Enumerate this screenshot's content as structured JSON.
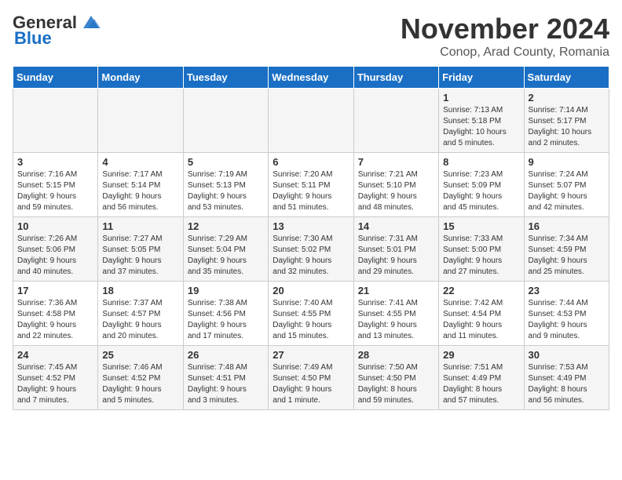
{
  "header": {
    "logo_line1": "General",
    "logo_line2": "Blue",
    "month": "November 2024",
    "location": "Conop, Arad County, Romania"
  },
  "weekdays": [
    "Sunday",
    "Monday",
    "Tuesday",
    "Wednesday",
    "Thursday",
    "Friday",
    "Saturday"
  ],
  "weeks": [
    [
      {
        "day": "",
        "info": ""
      },
      {
        "day": "",
        "info": ""
      },
      {
        "day": "",
        "info": ""
      },
      {
        "day": "",
        "info": ""
      },
      {
        "day": "",
        "info": ""
      },
      {
        "day": "1",
        "info": "Sunrise: 7:13 AM\nSunset: 5:18 PM\nDaylight: 10 hours\nand 5 minutes."
      },
      {
        "day": "2",
        "info": "Sunrise: 7:14 AM\nSunset: 5:17 PM\nDaylight: 10 hours\nand 2 minutes."
      }
    ],
    [
      {
        "day": "3",
        "info": "Sunrise: 7:16 AM\nSunset: 5:15 PM\nDaylight: 9 hours\nand 59 minutes."
      },
      {
        "day": "4",
        "info": "Sunrise: 7:17 AM\nSunset: 5:14 PM\nDaylight: 9 hours\nand 56 minutes."
      },
      {
        "day": "5",
        "info": "Sunrise: 7:19 AM\nSunset: 5:13 PM\nDaylight: 9 hours\nand 53 minutes."
      },
      {
        "day": "6",
        "info": "Sunrise: 7:20 AM\nSunset: 5:11 PM\nDaylight: 9 hours\nand 51 minutes."
      },
      {
        "day": "7",
        "info": "Sunrise: 7:21 AM\nSunset: 5:10 PM\nDaylight: 9 hours\nand 48 minutes."
      },
      {
        "day": "8",
        "info": "Sunrise: 7:23 AM\nSunset: 5:09 PM\nDaylight: 9 hours\nand 45 minutes."
      },
      {
        "day": "9",
        "info": "Sunrise: 7:24 AM\nSunset: 5:07 PM\nDaylight: 9 hours\nand 42 minutes."
      }
    ],
    [
      {
        "day": "10",
        "info": "Sunrise: 7:26 AM\nSunset: 5:06 PM\nDaylight: 9 hours\nand 40 minutes."
      },
      {
        "day": "11",
        "info": "Sunrise: 7:27 AM\nSunset: 5:05 PM\nDaylight: 9 hours\nand 37 minutes."
      },
      {
        "day": "12",
        "info": "Sunrise: 7:29 AM\nSunset: 5:04 PM\nDaylight: 9 hours\nand 35 minutes."
      },
      {
        "day": "13",
        "info": "Sunrise: 7:30 AM\nSunset: 5:02 PM\nDaylight: 9 hours\nand 32 minutes."
      },
      {
        "day": "14",
        "info": "Sunrise: 7:31 AM\nSunset: 5:01 PM\nDaylight: 9 hours\nand 29 minutes."
      },
      {
        "day": "15",
        "info": "Sunrise: 7:33 AM\nSunset: 5:00 PM\nDaylight: 9 hours\nand 27 minutes."
      },
      {
        "day": "16",
        "info": "Sunrise: 7:34 AM\nSunset: 4:59 PM\nDaylight: 9 hours\nand 25 minutes."
      }
    ],
    [
      {
        "day": "17",
        "info": "Sunrise: 7:36 AM\nSunset: 4:58 PM\nDaylight: 9 hours\nand 22 minutes."
      },
      {
        "day": "18",
        "info": "Sunrise: 7:37 AM\nSunset: 4:57 PM\nDaylight: 9 hours\nand 20 minutes."
      },
      {
        "day": "19",
        "info": "Sunrise: 7:38 AM\nSunset: 4:56 PM\nDaylight: 9 hours\nand 17 minutes."
      },
      {
        "day": "20",
        "info": "Sunrise: 7:40 AM\nSunset: 4:55 PM\nDaylight: 9 hours\nand 15 minutes."
      },
      {
        "day": "21",
        "info": "Sunrise: 7:41 AM\nSunset: 4:55 PM\nDaylight: 9 hours\nand 13 minutes."
      },
      {
        "day": "22",
        "info": "Sunrise: 7:42 AM\nSunset: 4:54 PM\nDaylight: 9 hours\nand 11 minutes."
      },
      {
        "day": "23",
        "info": "Sunrise: 7:44 AM\nSunset: 4:53 PM\nDaylight: 9 hours\nand 9 minutes."
      }
    ],
    [
      {
        "day": "24",
        "info": "Sunrise: 7:45 AM\nSunset: 4:52 PM\nDaylight: 9 hours\nand 7 minutes."
      },
      {
        "day": "25",
        "info": "Sunrise: 7:46 AM\nSunset: 4:52 PM\nDaylight: 9 hours\nand 5 minutes."
      },
      {
        "day": "26",
        "info": "Sunrise: 7:48 AM\nSunset: 4:51 PM\nDaylight: 9 hours\nand 3 minutes."
      },
      {
        "day": "27",
        "info": "Sunrise: 7:49 AM\nSunset: 4:50 PM\nDaylight: 9 hours\nand 1 minute."
      },
      {
        "day": "28",
        "info": "Sunrise: 7:50 AM\nSunset: 4:50 PM\nDaylight: 8 hours\nand 59 minutes."
      },
      {
        "day": "29",
        "info": "Sunrise: 7:51 AM\nSunset: 4:49 PM\nDaylight: 8 hours\nand 57 minutes."
      },
      {
        "day": "30",
        "info": "Sunrise: 7:53 AM\nSunset: 4:49 PM\nDaylight: 8 hours\nand 56 minutes."
      }
    ]
  ]
}
